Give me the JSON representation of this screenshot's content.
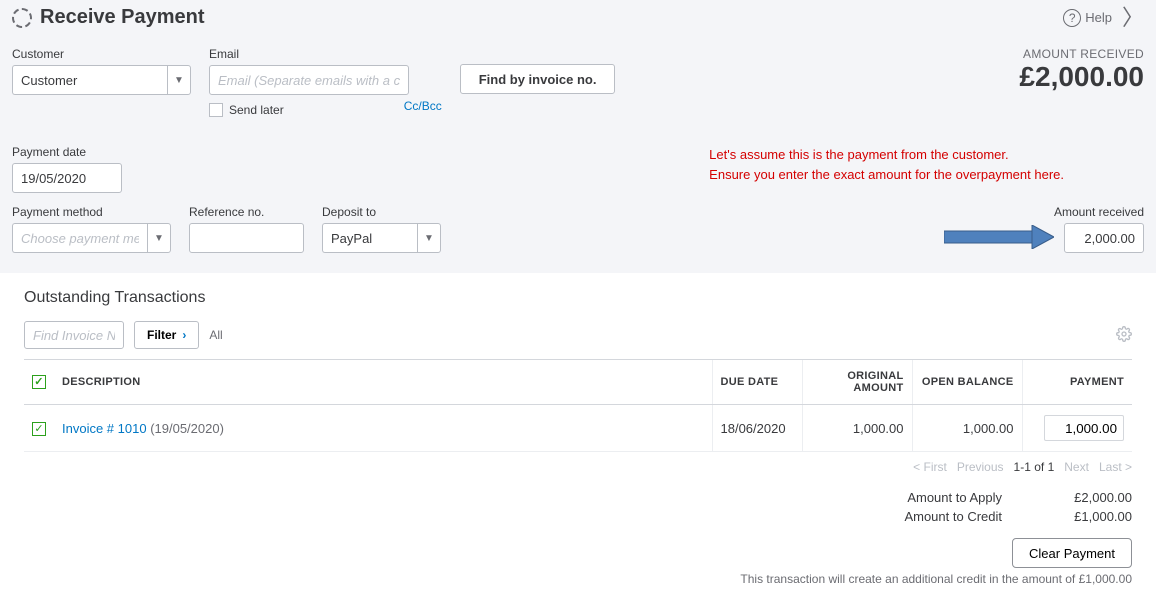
{
  "header": {
    "title": "Receive Payment",
    "help": "Help"
  },
  "fields": {
    "customer_label": "Customer",
    "customer_value": "Customer",
    "email_label": "Email",
    "email_placeholder": "Email (Separate emails with a comma)",
    "send_later": "Send later",
    "ccbcc": "Cc/Bcc",
    "find_btn": "Find by invoice no.",
    "payment_date_label": "Payment date",
    "payment_date_value": "19/05/2020",
    "payment_method_label": "Payment method",
    "payment_method_placeholder": "Choose payment method",
    "reference_label": "Reference no.",
    "deposit_label": "Deposit to",
    "deposit_value": "PayPal",
    "amount_received_header_label": "AMOUNT RECEIVED",
    "amount_received_header_value": "£2,000.00",
    "amount_received_label": "Amount received",
    "amount_received_value": "2,000.00"
  },
  "annotation": {
    "line1": "Let's assume this is the payment from the customer.",
    "line2": "Ensure you enter the exact amount for the overpayment here."
  },
  "outstanding": {
    "title": "Outstanding Transactions",
    "find_placeholder": "Find Invoice No.",
    "filter_label": "Filter",
    "all_label": "All",
    "cols": {
      "desc": "DESCRIPTION",
      "due": "DUE DATE",
      "orig": "ORIGINAL AMOUNT",
      "open": "OPEN BALANCE",
      "pay": "PAYMENT"
    },
    "rows": [
      {
        "desc_link": "Invoice # 1010",
        "desc_date": " (19/05/2020)",
        "due": "18/06/2020",
        "orig": "1,000.00",
        "open": "1,000.00",
        "payment": "1,000.00"
      }
    ],
    "pager": {
      "first": "< First",
      "prev": "Previous",
      "range": "1-1 of 1",
      "next": "Next",
      "last": "Last >"
    }
  },
  "totals": {
    "apply_label": "Amount to Apply",
    "apply_value": "£2,000.00",
    "credit_label": "Amount to Credit",
    "credit_value": "£1,000.00",
    "clear_btn": "Clear Payment",
    "note": "This transaction will create an additional credit in the amount of £1,000.00"
  }
}
